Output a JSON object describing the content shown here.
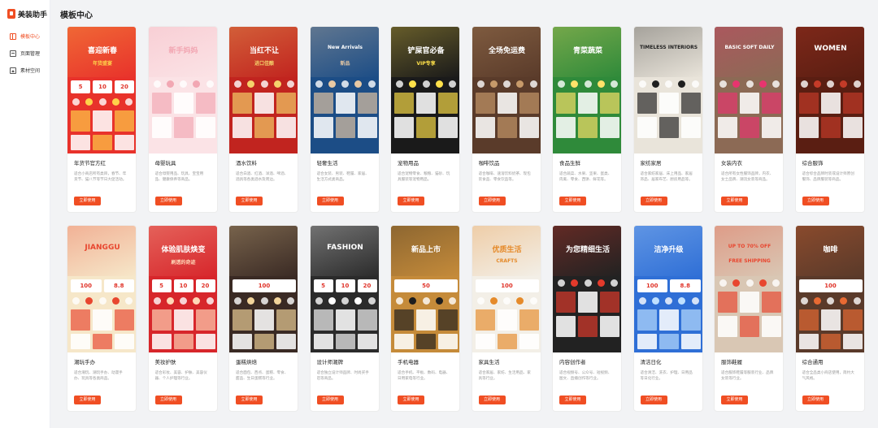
{
  "brand": {
    "name": "美装助手"
  },
  "nav": [
    {
      "label": "模板中心",
      "icon": "gift-icon",
      "active": true
    },
    {
      "label": "页面管理",
      "icon": "page-icon",
      "active": false
    },
    {
      "label": "素材空间",
      "icon": "image-icon",
      "active": false
    }
  ],
  "page": {
    "title": "模板中心"
  },
  "cards": [
    {
      "title": "年货节官方红",
      "desc": "适合小商店所有类目，春节、年货节、猫八节等节日大促活动。",
      "button": "立即使用",
      "thumb_text": "喜迎新春",
      "thumb_sub": "年货盛宴",
      "coupons": [
        "5",
        "10",
        "20"
      ],
      "bg": "#e8322b",
      "accent": "#ffd24a"
    },
    {
      "title": "母婴玩具",
      "desc": "适合母婴用品、玩具、宝宝用品、健康保养等商品。",
      "button": "立即使用",
      "thumb_text": "新手妈妈",
      "thumb_sub": "",
      "coupons": [],
      "bg": "#fbe3e6",
      "accent": "#f2a7b3"
    },
    {
      "title": "酒水饮料",
      "desc": "适合白酒、红酒、洋酒、啤酒、酒具等各类酒水及周边。",
      "button": "立即使用",
      "thumb_text": "当红不让",
      "thumb_sub": "进口佳酿",
      "coupons": [],
      "bg": "#c1241f",
      "accent": "#f5d36b"
    },
    {
      "title": "轻奢生活",
      "desc": "适合女装、男装、鞋履、家居、生活方式类商品。",
      "button": "立即使用",
      "thumb_text": "New Arrivals",
      "thumb_sub": "新品",
      "coupons": [],
      "bg": "#1c4d86",
      "accent": "#e8c9a4"
    },
    {
      "title": "宠物用品",
      "desc": "适合宠物零食、粮粮、猫砂、玩具服装等宠物用品。",
      "button": "立即使用",
      "thumb_text": "铲屎官必备",
      "thumb_sub": "VIP专享",
      "coupons": [],
      "bg": "#1a1a1a",
      "accent": "#ffe14a"
    },
    {
      "title": "咖啡饮品",
      "desc": "适合咖啡、速溶饮料奶茶、现包装食品、零食饮品等。",
      "button": "立即使用",
      "thumb_text": "全场免运费",
      "thumb_sub": "",
      "coupons": [],
      "bg": "#5a3b2a",
      "accent": "#c79a6a"
    },
    {
      "title": "食品生鲜",
      "desc": "适合蔬菜、水果、坚果、蛋类、肉禽、零食、西饼、鲜花等。",
      "button": "立即使用",
      "thumb_text": "青菜蔬菜",
      "thumb_sub": "",
      "coupons": [],
      "bg": "#2f8a3a",
      "accent": "#ffe26a"
    },
    {
      "title": "家纺家居",
      "desc": "适合家纺家居、床上用品、家居饰品、居家布艺、厨房用品等。",
      "button": "立即使用",
      "thumb_text": "TIMELESS INTERIORS",
      "thumb_sub": "",
      "coupons": [],
      "bg": "#e9e4da",
      "accent": "#1f1f1f"
    },
    {
      "title": "女装内衣",
      "desc": "适合所有女性服饰品牌，内衣、女士品牌、潮流女装等商品。",
      "button": "立即使用",
      "thumb_text": "BASIC SOFT DAILY",
      "thumb_sub": "",
      "coupons": [],
      "bg": "#8c6a55",
      "accent": "#e8346f"
    },
    {
      "title": "综合服饰",
      "desc": "适合综合品牌时装或设计师原创服饰、品牌服装等商品。",
      "button": "立即使用",
      "thumb_text": "WOMEN",
      "thumb_sub": "",
      "coupons": [],
      "bg": "#5a1e12",
      "accent": "#c43b28"
    },
    {
      "title": "潮玩手办",
      "desc": "适合潮玩、潮玩手办、动漫手办、玩具等各类商品。",
      "button": "立即使用",
      "thumb_text": "JIANGGU",
      "thumb_sub": "",
      "coupons": [
        "100",
        "8.8"
      ],
      "bg": "#f6e7c9",
      "accent": "#e8462f"
    },
    {
      "title": "美妆护肤",
      "desc": "适合彩妆、美容、护肤、美容仪器、个人护理等行业。",
      "button": "立即使用",
      "thumb_text": "体验肌肤焕变",
      "thumb_sub": "刷透的奇迹",
      "coupons": [
        "5",
        "10",
        "20"
      ],
      "bg": "#d7262b",
      "accent": "#ffd8b8"
    },
    {
      "title": "蛋糕烘焙",
      "desc": "适合面包、西点、蛋糕、零食、甜品、生日蛋糕等行业。",
      "button": "立即使用",
      "thumb_text": "",
      "thumb_sub": "",
      "coupons": [
        "100"
      ],
      "bg": "#3a2a24",
      "accent": "#f2d49b"
    },
    {
      "title": "设计师潮牌",
      "desc": "适合独立设计师品牌、时尚买手店等商品。",
      "button": "立即使用",
      "thumb_text": "FASHION",
      "thumb_sub": "",
      "coupons": [
        "5",
        "10",
        "20"
      ],
      "bg": "#2b2b2b",
      "accent": "#ffffff"
    },
    {
      "title": "手机电器",
      "desc": "适合手机、平板、数码、电器、日用家电等行业。",
      "button": "立即使用",
      "thumb_text": "新品上市",
      "thumb_sub": "",
      "coupons": [
        "50"
      ],
      "bg": "#c58b3a",
      "accent": "#1e1e1e"
    },
    {
      "title": "家具生活",
      "desc": "适合家居、家纺、生活用品、家具等行业。",
      "button": "立即使用",
      "thumb_text": "优质生活",
      "thumb_sub": "CRAFTS",
      "coupons": [
        "100"
      ],
      "bg": "#f3efe7",
      "accent": "#e58a2a"
    },
    {
      "title": "内容创作者",
      "desc": "适合视频号、公众号、短视频、图文、直播创作等行业。",
      "button": "立即使用",
      "thumb_text": "为您精细生活",
      "thumb_sub": "",
      "coupons": [],
      "bg": "#222222",
      "accent": "#e33a2b"
    },
    {
      "title": "清洁日化",
      "desc": "适合清洁、洗衣、护理、日用品等日化行业。",
      "button": "立即使用",
      "thumb_text": "洁净升级",
      "thumb_sub": "",
      "coupons": [
        "100",
        "8.8"
      ],
      "bg": "#2f6fd6",
      "accent": "#bfe0ff"
    },
    {
      "title": "服饰鞋履",
      "desc": "适合服饰鞋履等服装行业、品牌女装等行业。",
      "button": "立即使用",
      "thumb_text": "UP TO 70% OFF",
      "thumb_sub": "FREE SHIPPING",
      "coupons": [],
      "bg": "#d9c7b4",
      "accent": "#e8462f"
    },
    {
      "title": "综合通用",
      "desc": "适合全品类小商店使用，简约大气风格。",
      "button": "立即使用",
      "thumb_text": "咖啡",
      "thumb_sub": "",
      "coupons": [
        "100"
      ],
      "bg": "#5a3a2a",
      "accent": "#e86a33"
    }
  ]
}
